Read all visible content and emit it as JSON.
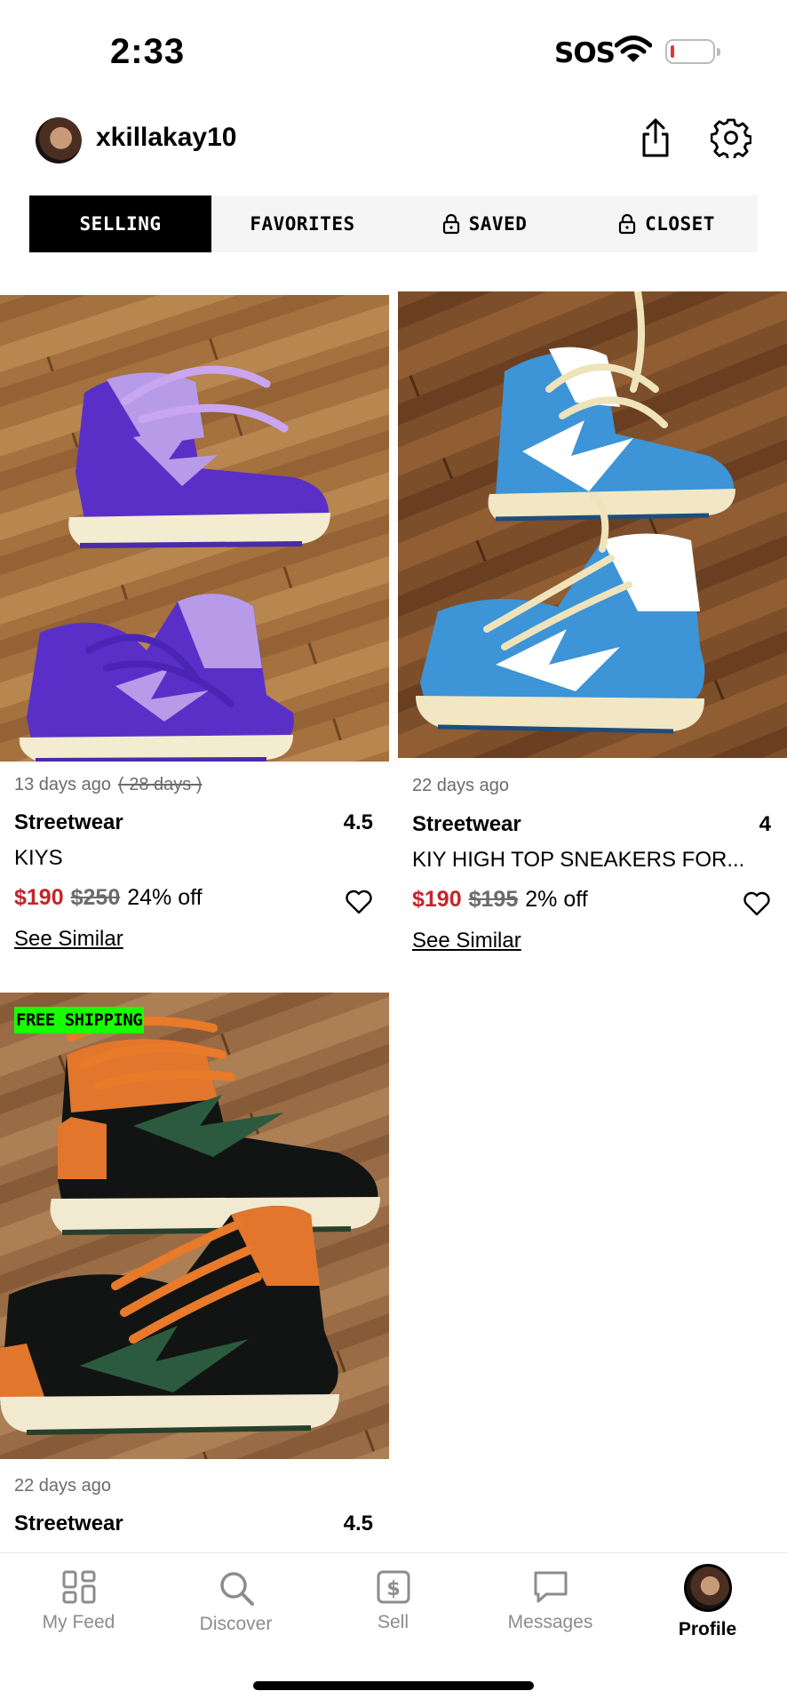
{
  "status_bar": {
    "time": "2:33",
    "carrier": "SOS"
  },
  "profile": {
    "username": "xkillakay10"
  },
  "tabs": [
    {
      "label": "SELLING",
      "active": true,
      "locked": false
    },
    {
      "label": "FAVORITES",
      "active": false,
      "locked": false
    },
    {
      "label": "SAVED",
      "active": false,
      "locked": true
    },
    {
      "label": "CLOSET",
      "active": false,
      "locked": true
    }
  ],
  "listings": [
    {
      "age": "13 days ago",
      "old_age": "( 28 days )",
      "brand": "Streetwear",
      "size": "4.5",
      "title": "KIYS",
      "price": "$190",
      "original_price": "$250",
      "discount": "24% off",
      "see_similar": "See Similar",
      "shoe_colors": {
        "main": "#5a2fc8",
        "accent": "#b79be8",
        "sole": "#f3ecd0"
      }
    },
    {
      "age": "22 days ago",
      "brand": "Streetwear",
      "size": "4",
      "title": "KIY HIGH TOP SNEAKERS FOR...",
      "price": "$190",
      "original_price": "$195",
      "discount": "2% off",
      "see_similar": "See Similar",
      "shoe_colors": {
        "main": "#3d94d6",
        "accent": "#ffffff",
        "sole": "#f1e7c4"
      }
    },
    {
      "badge": "FREE SHIPPING",
      "age": "22 days ago",
      "brand": "Streetwear",
      "size": "4.5",
      "shoe_colors": {
        "main": "#111413",
        "accent": "#e2762c",
        "sole": "#f2ead0",
        "bolt": "#2c5a3e"
      }
    }
  ],
  "bottom_nav": [
    {
      "label": "My Feed",
      "icon": "feed-grid-icon"
    },
    {
      "label": "Discover",
      "icon": "search-icon"
    },
    {
      "label": "Sell",
      "icon": "dollar-sign-icon"
    },
    {
      "label": "Messages",
      "icon": "chat-bubble-icon"
    },
    {
      "label": "Profile",
      "icon": "profile-avatar",
      "active": true
    }
  ],
  "colors": {
    "sale_price": "#c4252a",
    "free_shipping_badge": "#18ff00",
    "tab_active": "#000000"
  }
}
